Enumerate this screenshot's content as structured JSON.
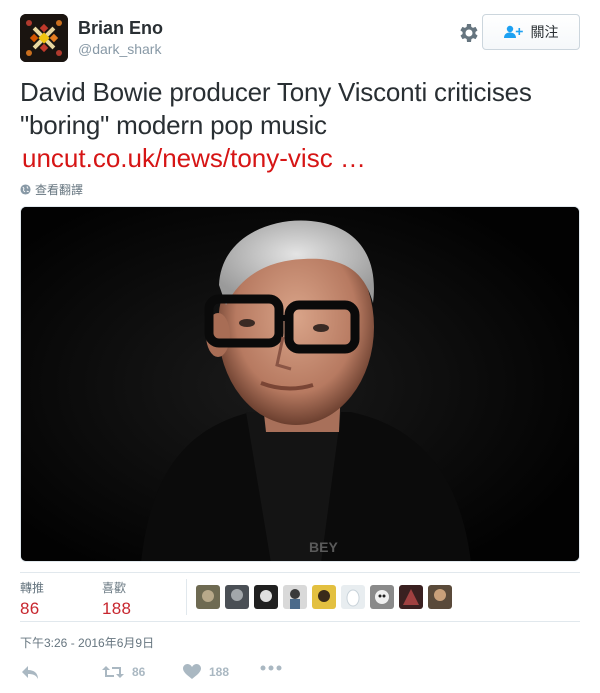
{
  "user": {
    "name": "Brian Eno",
    "handle": "@dark_shark"
  },
  "follow": {
    "label": "關注"
  },
  "tweet": {
    "text": "David Bowie producer Tony Visconti criticises \"boring\" modern pop music",
    "link": "uncut.co.uk/news/tony-visc …",
    "translate": "查看翻譯"
  },
  "stats": {
    "retweets_label": "轉推",
    "retweets_value": "86",
    "likes_label": "喜歡",
    "likes_value": "188"
  },
  "timestamp": "下午3:26 - 2016年6月9日",
  "actions": {
    "retweet_count": "86",
    "like_count": "188"
  },
  "colors": {
    "link": "#d61515",
    "stat_value": "#c7262e",
    "action_icon": "#aab8c2"
  },
  "icons": [
    "gear-icon",
    "follow-user-icon",
    "globe-icon",
    "reply-icon",
    "retweet-icon",
    "heart-icon",
    "more-icon"
  ]
}
